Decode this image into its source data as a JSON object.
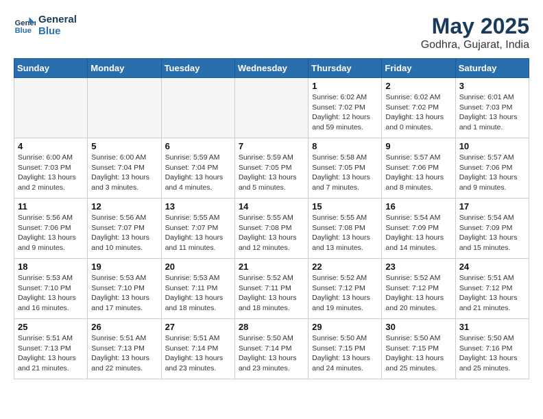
{
  "logo": {
    "line1": "General",
    "line2": "Blue"
  },
  "title": "May 2025",
  "subtitle": "Godhra, Gujarat, India",
  "days_of_week": [
    "Sunday",
    "Monday",
    "Tuesday",
    "Wednesday",
    "Thursday",
    "Friday",
    "Saturday"
  ],
  "weeks": [
    [
      {
        "day": "",
        "info": ""
      },
      {
        "day": "",
        "info": ""
      },
      {
        "day": "",
        "info": ""
      },
      {
        "day": "",
        "info": ""
      },
      {
        "day": "1",
        "info": "Sunrise: 6:02 AM\nSunset: 7:02 PM\nDaylight: 12 hours\nand 59 minutes."
      },
      {
        "day": "2",
        "info": "Sunrise: 6:02 AM\nSunset: 7:02 PM\nDaylight: 13 hours\nand 0 minutes."
      },
      {
        "day": "3",
        "info": "Sunrise: 6:01 AM\nSunset: 7:03 PM\nDaylight: 13 hours\nand 1 minute."
      }
    ],
    [
      {
        "day": "4",
        "info": "Sunrise: 6:00 AM\nSunset: 7:03 PM\nDaylight: 13 hours\nand 2 minutes."
      },
      {
        "day": "5",
        "info": "Sunrise: 6:00 AM\nSunset: 7:04 PM\nDaylight: 13 hours\nand 3 minutes."
      },
      {
        "day": "6",
        "info": "Sunrise: 5:59 AM\nSunset: 7:04 PM\nDaylight: 13 hours\nand 4 minutes."
      },
      {
        "day": "7",
        "info": "Sunrise: 5:59 AM\nSunset: 7:05 PM\nDaylight: 13 hours\nand 5 minutes."
      },
      {
        "day": "8",
        "info": "Sunrise: 5:58 AM\nSunset: 7:05 PM\nDaylight: 13 hours\nand 7 minutes."
      },
      {
        "day": "9",
        "info": "Sunrise: 5:57 AM\nSunset: 7:06 PM\nDaylight: 13 hours\nand 8 minutes."
      },
      {
        "day": "10",
        "info": "Sunrise: 5:57 AM\nSunset: 7:06 PM\nDaylight: 13 hours\nand 9 minutes."
      }
    ],
    [
      {
        "day": "11",
        "info": "Sunrise: 5:56 AM\nSunset: 7:06 PM\nDaylight: 13 hours\nand 9 minutes."
      },
      {
        "day": "12",
        "info": "Sunrise: 5:56 AM\nSunset: 7:07 PM\nDaylight: 13 hours\nand 10 minutes."
      },
      {
        "day": "13",
        "info": "Sunrise: 5:55 AM\nSunset: 7:07 PM\nDaylight: 13 hours\nand 11 minutes."
      },
      {
        "day": "14",
        "info": "Sunrise: 5:55 AM\nSunset: 7:08 PM\nDaylight: 13 hours\nand 12 minutes."
      },
      {
        "day": "15",
        "info": "Sunrise: 5:55 AM\nSunset: 7:08 PM\nDaylight: 13 hours\nand 13 minutes."
      },
      {
        "day": "16",
        "info": "Sunrise: 5:54 AM\nSunset: 7:09 PM\nDaylight: 13 hours\nand 14 minutes."
      },
      {
        "day": "17",
        "info": "Sunrise: 5:54 AM\nSunset: 7:09 PM\nDaylight: 13 hours\nand 15 minutes."
      }
    ],
    [
      {
        "day": "18",
        "info": "Sunrise: 5:53 AM\nSunset: 7:10 PM\nDaylight: 13 hours\nand 16 minutes."
      },
      {
        "day": "19",
        "info": "Sunrise: 5:53 AM\nSunset: 7:10 PM\nDaylight: 13 hours\nand 17 minutes."
      },
      {
        "day": "20",
        "info": "Sunrise: 5:53 AM\nSunset: 7:11 PM\nDaylight: 13 hours\nand 18 minutes."
      },
      {
        "day": "21",
        "info": "Sunrise: 5:52 AM\nSunset: 7:11 PM\nDaylight: 13 hours\nand 18 minutes."
      },
      {
        "day": "22",
        "info": "Sunrise: 5:52 AM\nSunset: 7:12 PM\nDaylight: 13 hours\nand 19 minutes."
      },
      {
        "day": "23",
        "info": "Sunrise: 5:52 AM\nSunset: 7:12 PM\nDaylight: 13 hours\nand 20 minutes."
      },
      {
        "day": "24",
        "info": "Sunrise: 5:51 AM\nSunset: 7:12 PM\nDaylight: 13 hours\nand 21 minutes."
      }
    ],
    [
      {
        "day": "25",
        "info": "Sunrise: 5:51 AM\nSunset: 7:13 PM\nDaylight: 13 hours\nand 21 minutes."
      },
      {
        "day": "26",
        "info": "Sunrise: 5:51 AM\nSunset: 7:13 PM\nDaylight: 13 hours\nand 22 minutes."
      },
      {
        "day": "27",
        "info": "Sunrise: 5:51 AM\nSunset: 7:14 PM\nDaylight: 13 hours\nand 23 minutes."
      },
      {
        "day": "28",
        "info": "Sunrise: 5:50 AM\nSunset: 7:14 PM\nDaylight: 13 hours\nand 23 minutes."
      },
      {
        "day": "29",
        "info": "Sunrise: 5:50 AM\nSunset: 7:15 PM\nDaylight: 13 hours\nand 24 minutes."
      },
      {
        "day": "30",
        "info": "Sunrise: 5:50 AM\nSunset: 7:15 PM\nDaylight: 13 hours\nand 25 minutes."
      },
      {
        "day": "31",
        "info": "Sunrise: 5:50 AM\nSunset: 7:16 PM\nDaylight: 13 hours\nand 25 minutes."
      }
    ]
  ]
}
